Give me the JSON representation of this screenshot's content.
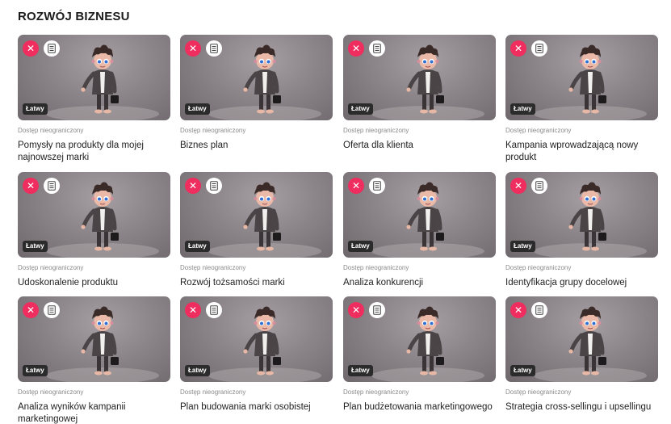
{
  "section": {
    "title": "ROZWÓJ BIZNESU"
  },
  "colors": {
    "accent": "#ef2d5e",
    "badge": "#2b2b2b",
    "muted_text": "#8a8a8a"
  },
  "icons": {
    "remove": "close-icon",
    "details": "document-icon"
  },
  "cards": [
    {
      "difficulty": "Łatwy",
      "access": "Dostęp nieograniczony",
      "title": "Pomysły na produkty dla mojej najnowszej marki"
    },
    {
      "difficulty": "Łatwy",
      "access": "Dostęp nieograniczony",
      "title": "Biznes plan"
    },
    {
      "difficulty": "Łatwy",
      "access": "Dostęp nieograniczony",
      "title": "Oferta dla klienta"
    },
    {
      "difficulty": "Łatwy",
      "access": "Dostęp nieograniczony",
      "title": "Kampania wprowadzającą nowy produkt"
    },
    {
      "difficulty": "Łatwy",
      "access": "Dostęp nieograniczony",
      "title": "Udoskonalenie produktu"
    },
    {
      "difficulty": "Łatwy",
      "access": "Dostęp nieograniczony",
      "title": "Rozwój tożsamości marki"
    },
    {
      "difficulty": "Łatwy",
      "access": "Dostęp nieograniczony",
      "title": "Analiza konkurencji"
    },
    {
      "difficulty": "Łatwy",
      "access": "Dostęp nieograniczony",
      "title": "Identyfikacja grupy docelowej"
    },
    {
      "difficulty": "Łatwy",
      "access": "Dostęp nieograniczony",
      "title": "Analiza wyników kampanii marketingowej"
    },
    {
      "difficulty": "Łatwy",
      "access": "Dostęp nieograniczony",
      "title": "Plan budowania marki osobistej"
    },
    {
      "difficulty": "Łatwy",
      "access": "Dostęp nieograniczony",
      "title": "Plan budżetowania marketingowego"
    },
    {
      "difficulty": "Łatwy",
      "access": "Dostęp nieograniczony",
      "title": "Strategia cross-sellingu i upsellingu"
    }
  ]
}
